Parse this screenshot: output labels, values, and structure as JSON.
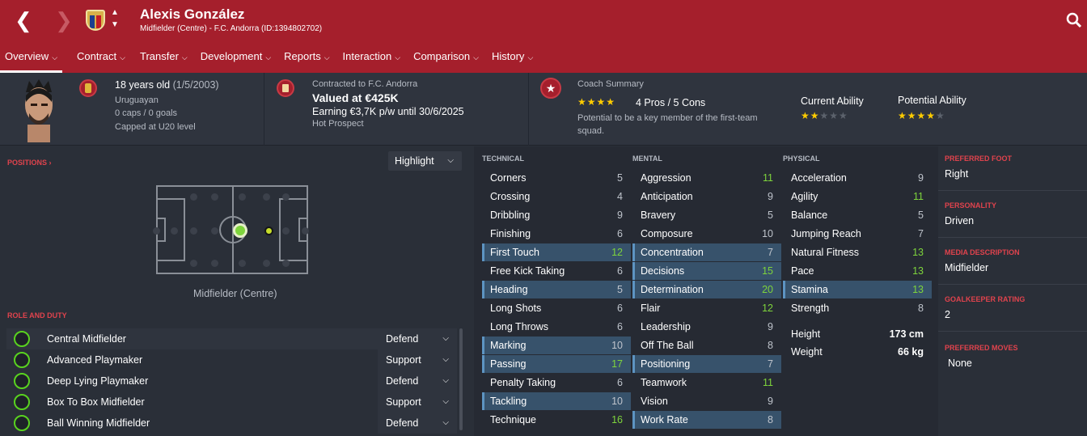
{
  "header": {
    "name": "Alexis González",
    "subtitle": "Midfielder (Centre) - F.C. Andorra (ID:1394802702)",
    "tabs": [
      {
        "label": "Overview"
      },
      {
        "label": "Contract"
      },
      {
        "label": "Transfer"
      },
      {
        "label": "Development"
      },
      {
        "label": "Reports"
      },
      {
        "label": "Interaction"
      },
      {
        "label": "Comparison"
      },
      {
        "label": "History"
      }
    ]
  },
  "bio": {
    "age": "18 years old",
    "dob": "(1/5/2003)",
    "nationality": "Uruguayan",
    "caps": "0 caps / 0 goals",
    "capped": "Capped at U20 level"
  },
  "contract": {
    "contracted": "Contracted to F.C. Andorra",
    "value": "Valued at €425K",
    "earning": "Earning €3,7K p/w until 30/6/2025",
    "status": "Hot Prospect"
  },
  "coach": {
    "title": "Coach Summary",
    "stars": "★★★★",
    "pros_cons": "4 Pros / 5 Cons",
    "potential_text_1": "Potential to be a key member of the first-team",
    "potential_text_2": "squad.",
    "current_label": "Current Ability",
    "current_stars_on": "★★",
    "current_stars_off": "★★★",
    "potential_label": "Potential Ability",
    "potential_stars_on": "★★★★",
    "potential_stars_off": "★"
  },
  "positions": {
    "label": "POSITIONS",
    "highlight": "Highlight",
    "pos_text": "Midfielder (Centre)"
  },
  "roles": {
    "label": "ROLE AND DUTY",
    "items": [
      {
        "name": "Central Midfielder",
        "duty": "Defend"
      },
      {
        "name": "Advanced Playmaker",
        "duty": "Support"
      },
      {
        "name": "Deep Lying Playmaker",
        "duty": "Defend"
      },
      {
        "name": "Box To Box Midfielder",
        "duty": "Support"
      },
      {
        "name": "Ball Winning Midfielder",
        "duty": "Defend"
      }
    ]
  },
  "technical": {
    "label": "TECHNICAL",
    "items": [
      {
        "name": "Corners",
        "value": "5"
      },
      {
        "name": "Crossing",
        "value": "4"
      },
      {
        "name": "Dribbling",
        "value": "9"
      },
      {
        "name": "Finishing",
        "value": "6"
      },
      {
        "name": "First Touch",
        "value": "12"
      },
      {
        "name": "Free Kick Taking",
        "value": "6"
      },
      {
        "name": "Heading",
        "value": "5"
      },
      {
        "name": "Long Shots",
        "value": "6"
      },
      {
        "name": "Long Throws",
        "value": "6"
      },
      {
        "name": "Marking",
        "value": "10"
      },
      {
        "name": "Passing",
        "value": "17"
      },
      {
        "name": "Penalty Taking",
        "value": "6"
      },
      {
        "name": "Tackling",
        "value": "10"
      },
      {
        "name": "Technique",
        "value": "16"
      }
    ]
  },
  "mental": {
    "label": "MENTAL",
    "items": [
      {
        "name": "Aggression",
        "value": "11"
      },
      {
        "name": "Anticipation",
        "value": "9"
      },
      {
        "name": "Bravery",
        "value": "5"
      },
      {
        "name": "Composure",
        "value": "10"
      },
      {
        "name": "Concentration",
        "value": "7"
      },
      {
        "name": "Decisions",
        "value": "15"
      },
      {
        "name": "Determination",
        "value": "20"
      },
      {
        "name": "Flair",
        "value": "12"
      },
      {
        "name": "Leadership",
        "value": "9"
      },
      {
        "name": "Off The Ball",
        "value": "8"
      },
      {
        "name": "Positioning",
        "value": "7"
      },
      {
        "name": "Teamwork",
        "value": "11"
      },
      {
        "name": "Vision",
        "value": "9"
      },
      {
        "name": "Work Rate",
        "value": "8"
      }
    ]
  },
  "physical": {
    "label": "PHYSICAL",
    "items": [
      {
        "name": "Acceleration",
        "value": "9"
      },
      {
        "name": "Agility",
        "value": "11"
      },
      {
        "name": "Balance",
        "value": "5"
      },
      {
        "name": "Jumping Reach",
        "value": "7"
      },
      {
        "name": "Natural Fitness",
        "value": "13"
      },
      {
        "name": "Pace",
        "value": "13"
      },
      {
        "name": "Stamina",
        "value": "13"
      },
      {
        "name": "Strength",
        "value": "8"
      }
    ],
    "height_label": "Height",
    "height": "173 cm",
    "weight_label": "Weight",
    "weight": "66 kg"
  },
  "profile": {
    "foot_label": "PREFERRED FOOT",
    "foot": "Right",
    "personality_label": "PERSONALITY",
    "personality": "Driven",
    "media_label": "MEDIA DESCRIPTION",
    "media": "Midfielder",
    "gk_label": "GOALKEEPER RATING",
    "gk": "2",
    "moves_label": "PREFERRED MOVES",
    "moves": "None"
  },
  "colors": {
    "header": "#a51f2c",
    "accent_green": "#7ed43c",
    "highlight": "#37526b"
  }
}
